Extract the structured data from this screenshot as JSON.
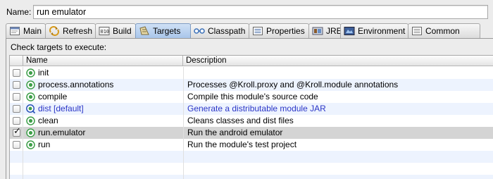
{
  "name": {
    "label": "Name:",
    "value": "run emulator"
  },
  "tabs": [
    {
      "label": "Main",
      "icon": "main-icon",
      "active": false
    },
    {
      "label": "Refresh",
      "icon": "refresh-icon",
      "active": false
    },
    {
      "label": "Build",
      "icon": "build-icon",
      "active": false
    },
    {
      "label": "Targets",
      "icon": "targets-icon",
      "active": true
    },
    {
      "label": "Classpath",
      "icon": "classpath-icon",
      "active": false
    },
    {
      "label": "Properties",
      "icon": "properties-icon",
      "active": false
    },
    {
      "label": "JRE",
      "icon": "jre-icon",
      "active": false
    },
    {
      "label": "Environment",
      "icon": "environment-icon",
      "active": false
    },
    {
      "label": "Common",
      "icon": "common-icon",
      "active": false
    }
  ],
  "panel": {
    "instruction": "Check targets to execute:",
    "columns": {
      "name": "Name",
      "description": "Description"
    },
    "targets": [
      {
        "name": "init",
        "description": "",
        "checked": false,
        "default": false
      },
      {
        "name": "process.annotations",
        "description": "Processes @Kroll.proxy and @Kroll.module annotations",
        "checked": false,
        "default": false
      },
      {
        "name": "compile",
        "description": "Compile this module's source code",
        "checked": false,
        "default": false
      },
      {
        "name": "dist [default]",
        "description": "Generate a distributable module JAR",
        "checked": false,
        "default": true
      },
      {
        "name": "clean",
        "description": "Cleans classes and dist files",
        "checked": false,
        "default": false
      },
      {
        "name": "run.emulator",
        "description": "Run the android emulator",
        "checked": true,
        "default": false,
        "selected": true
      },
      {
        "name": "run",
        "description": "Run the module's test project",
        "checked": false,
        "default": false
      }
    ]
  },
  "colors": {
    "default_target_text": "#2a35c7",
    "selected_row": "#d4d4d4",
    "alt_row": "#edf3fe",
    "target_icon": "#3f9f4a"
  }
}
